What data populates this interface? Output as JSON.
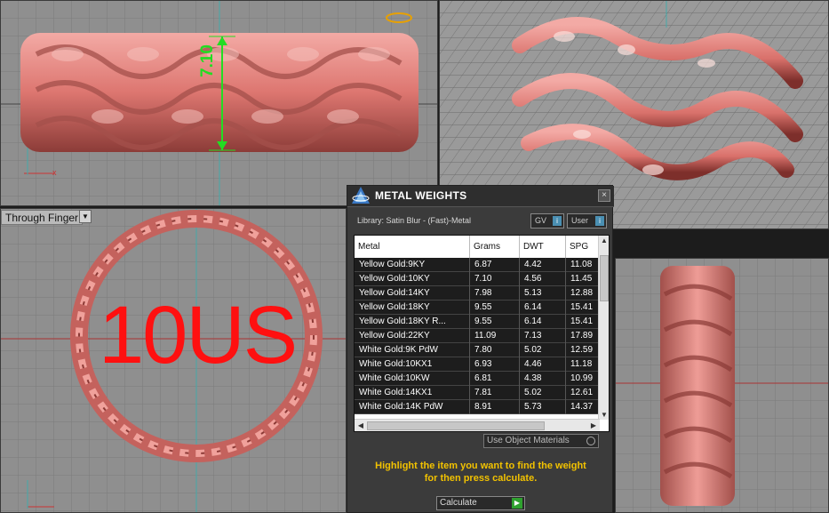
{
  "viewports": {
    "bottom_left": {
      "label": "Through Finger",
      "ring_size_text": "10US"
    },
    "top_left": {
      "dimension_text": "7.10"
    }
  },
  "panel": {
    "title": "METAL WEIGHTS",
    "close_glyph": "×",
    "library_text": "Library: Satin Blur - (Fast)-Metal",
    "gv_label": "GV",
    "user_label": "User",
    "columns": [
      "Metal",
      "Grams",
      "DWT",
      "SPG"
    ],
    "rows": [
      [
        "Yellow Gold:9KY",
        "6.87",
        "4.42",
        "11.08"
      ],
      [
        "Yellow Gold:10KY",
        "7.10",
        "4.56",
        "11.45"
      ],
      [
        "Yellow Gold:14KY",
        "7.98",
        "5.13",
        "12.88"
      ],
      [
        "Yellow Gold:18KY",
        "9.55",
        "6.14",
        "15.41"
      ],
      [
        "Yellow Gold:18KY R...",
        "9.55",
        "6.14",
        "15.41"
      ],
      [
        "Yellow Gold:22KY",
        "11.09",
        "7.13",
        "17.89"
      ],
      [
        "White Gold:9K PdW",
        "7.80",
        "5.02",
        "12.59"
      ],
      [
        "White Gold:10KX1",
        "6.93",
        "4.46",
        "11.18"
      ],
      [
        "White Gold:10KW",
        "6.81",
        "4.38",
        "10.99"
      ],
      [
        "White Gold:14KX1",
        "7.81",
        "5.02",
        "12.61"
      ],
      [
        "White Gold:14K PdW",
        "8.91",
        "5.73",
        "14.37"
      ]
    ],
    "object_materials_label": "Use Object Materials",
    "hint_line1": "Highlight the item you want to find the weight",
    "hint_line2": "for then press calculate.",
    "calculate_label": "Calculate"
  },
  "colors": {
    "metal": "#e07c78",
    "viewport_bg": "#8f8f8f",
    "grid": "#7b7b7b",
    "hint": "#f2c200",
    "size_text": "#ff1010",
    "dimension": "#22dd22"
  }
}
